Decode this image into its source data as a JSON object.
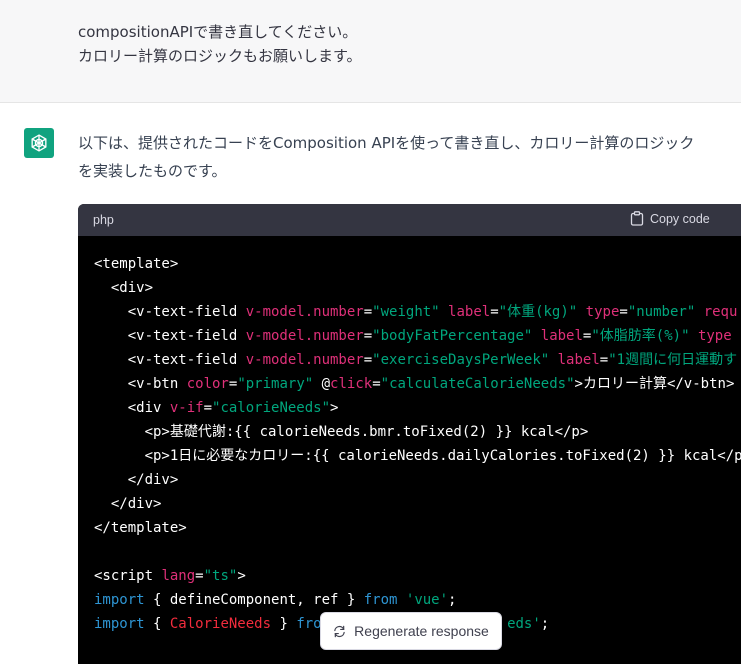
{
  "user_message": {
    "lines": [
      "compositionAPIで書き直してください。",
      "カロリー計算のロジックもお願いします。"
    ]
  },
  "assistant": {
    "avatar_icon": "openai-logo-icon",
    "intro_lines": [
      "以下は、提供されたコードをComposition APIを使って書き直し、カロリー計算のロジック",
      "を実装したものです。"
    ]
  },
  "code_block": {
    "language": "php",
    "copy_label": "Copy code",
    "copy_icon": "clipboard-icon",
    "lines": [
      [
        {
          "t": "<template>",
          "c": "tag"
        }
      ],
      [
        {
          "t": "  <div>",
          "c": "tag"
        }
      ],
      [
        {
          "t": "    <v-text-field ",
          "c": "tag"
        },
        {
          "t": "v-model.number",
          "c": "attr"
        },
        {
          "t": "=",
          "c": "tag"
        },
        {
          "t": "\"weight\"",
          "c": "str"
        },
        {
          "t": " ",
          "c": "tag"
        },
        {
          "t": "label",
          "c": "attr"
        },
        {
          "t": "=",
          "c": "tag"
        },
        {
          "t": "\"体重(kg)\"",
          "c": "str"
        },
        {
          "t": " ",
          "c": "tag"
        },
        {
          "t": "type",
          "c": "attr"
        },
        {
          "t": "=",
          "c": "tag"
        },
        {
          "t": "\"number\"",
          "c": "str"
        },
        {
          "t": " ",
          "c": "tag"
        },
        {
          "t": "requ",
          "c": "attr"
        }
      ],
      [
        {
          "t": "    <v-text-field ",
          "c": "tag"
        },
        {
          "t": "v-model.number",
          "c": "attr"
        },
        {
          "t": "=",
          "c": "tag"
        },
        {
          "t": "\"bodyFatPercentage\"",
          "c": "str"
        },
        {
          "t": " ",
          "c": "tag"
        },
        {
          "t": "label",
          "c": "attr"
        },
        {
          "t": "=",
          "c": "tag"
        },
        {
          "t": "\"体脂肪率(%)\"",
          "c": "str"
        },
        {
          "t": " ",
          "c": "tag"
        },
        {
          "t": "type",
          "c": "attr"
        }
      ],
      [
        {
          "t": "    <v-text-field ",
          "c": "tag"
        },
        {
          "t": "v-model.number",
          "c": "attr"
        },
        {
          "t": "=",
          "c": "tag"
        },
        {
          "t": "\"exerciseDaysPerWeek\"",
          "c": "str"
        },
        {
          "t": " ",
          "c": "tag"
        },
        {
          "t": "label",
          "c": "attr"
        },
        {
          "t": "=",
          "c": "tag"
        },
        {
          "t": "\"1週間に何日運動す",
          "c": "str"
        }
      ],
      [
        {
          "t": "    <v-btn ",
          "c": "tag"
        },
        {
          "t": "color",
          "c": "attr"
        },
        {
          "t": "=",
          "c": "tag"
        },
        {
          "t": "\"primary\"",
          "c": "str"
        },
        {
          "t": " ",
          "c": "tag"
        },
        {
          "t": "@",
          "c": "tag"
        },
        {
          "t": "click",
          "c": "attr"
        },
        {
          "t": "=",
          "c": "tag"
        },
        {
          "t": "\"calculateCalorieNeeds\"",
          "c": "str"
        },
        {
          "t": ">カロリー計算</v-btn>",
          "c": "tag"
        }
      ],
      [
        {
          "t": "    <div ",
          "c": "tag"
        },
        {
          "t": "v-if",
          "c": "attr"
        },
        {
          "t": "=",
          "c": "tag"
        },
        {
          "t": "\"calorieNeeds\"",
          "c": "str"
        },
        {
          "t": ">",
          "c": "tag"
        }
      ],
      [
        {
          "t": "      <p>基礎代謝:{{ calorieNeeds.bmr.toFixed(2) }} kcal</p>",
          "c": "tag"
        }
      ],
      [
        {
          "t": "      <p>1日に必要なカロリー:{{ calorieNeeds.dailyCalories.toFixed(2) }} kcal</p>",
          "c": "tag"
        }
      ],
      [
        {
          "t": "    </div>",
          "c": "tag"
        }
      ],
      [
        {
          "t": "  </div>",
          "c": "tag"
        }
      ],
      [
        {
          "t": "</template>",
          "c": "tag"
        }
      ],
      [],
      [
        {
          "t": "<script ",
          "c": "tag"
        },
        {
          "t": "lang",
          "c": "attr"
        },
        {
          "t": "=",
          "c": "tag"
        },
        {
          "t": "\"ts\"",
          "c": "str"
        },
        {
          "t": ">",
          "c": "tag"
        }
      ],
      [
        {
          "t": "import",
          "c": "kw"
        },
        {
          "t": " { defineComponent, ref } ",
          "c": "tag"
        },
        {
          "t": "from",
          "c": "kw"
        },
        {
          "t": " ",
          "c": "tag"
        },
        {
          "t": "'vue'",
          "c": "str"
        },
        {
          "t": ";",
          "c": "tag"
        }
      ],
      [
        {
          "t": "import",
          "c": "kw"
        },
        {
          "t": " { ",
          "c": "tag"
        },
        {
          "t": "CalorieNeeds",
          "c": "cls"
        },
        {
          "t": " } ",
          "c": "tag"
        },
        {
          "t": "fro",
          "c": "kw"
        },
        {
          "t": "                      ",
          "c": "tag"
        },
        {
          "t": "eds'",
          "c": "str"
        },
        {
          "t": ";",
          "c": "tag"
        }
      ]
    ]
  },
  "regenerate": {
    "icon": "refresh-icon",
    "label": "Regenerate response"
  }
}
